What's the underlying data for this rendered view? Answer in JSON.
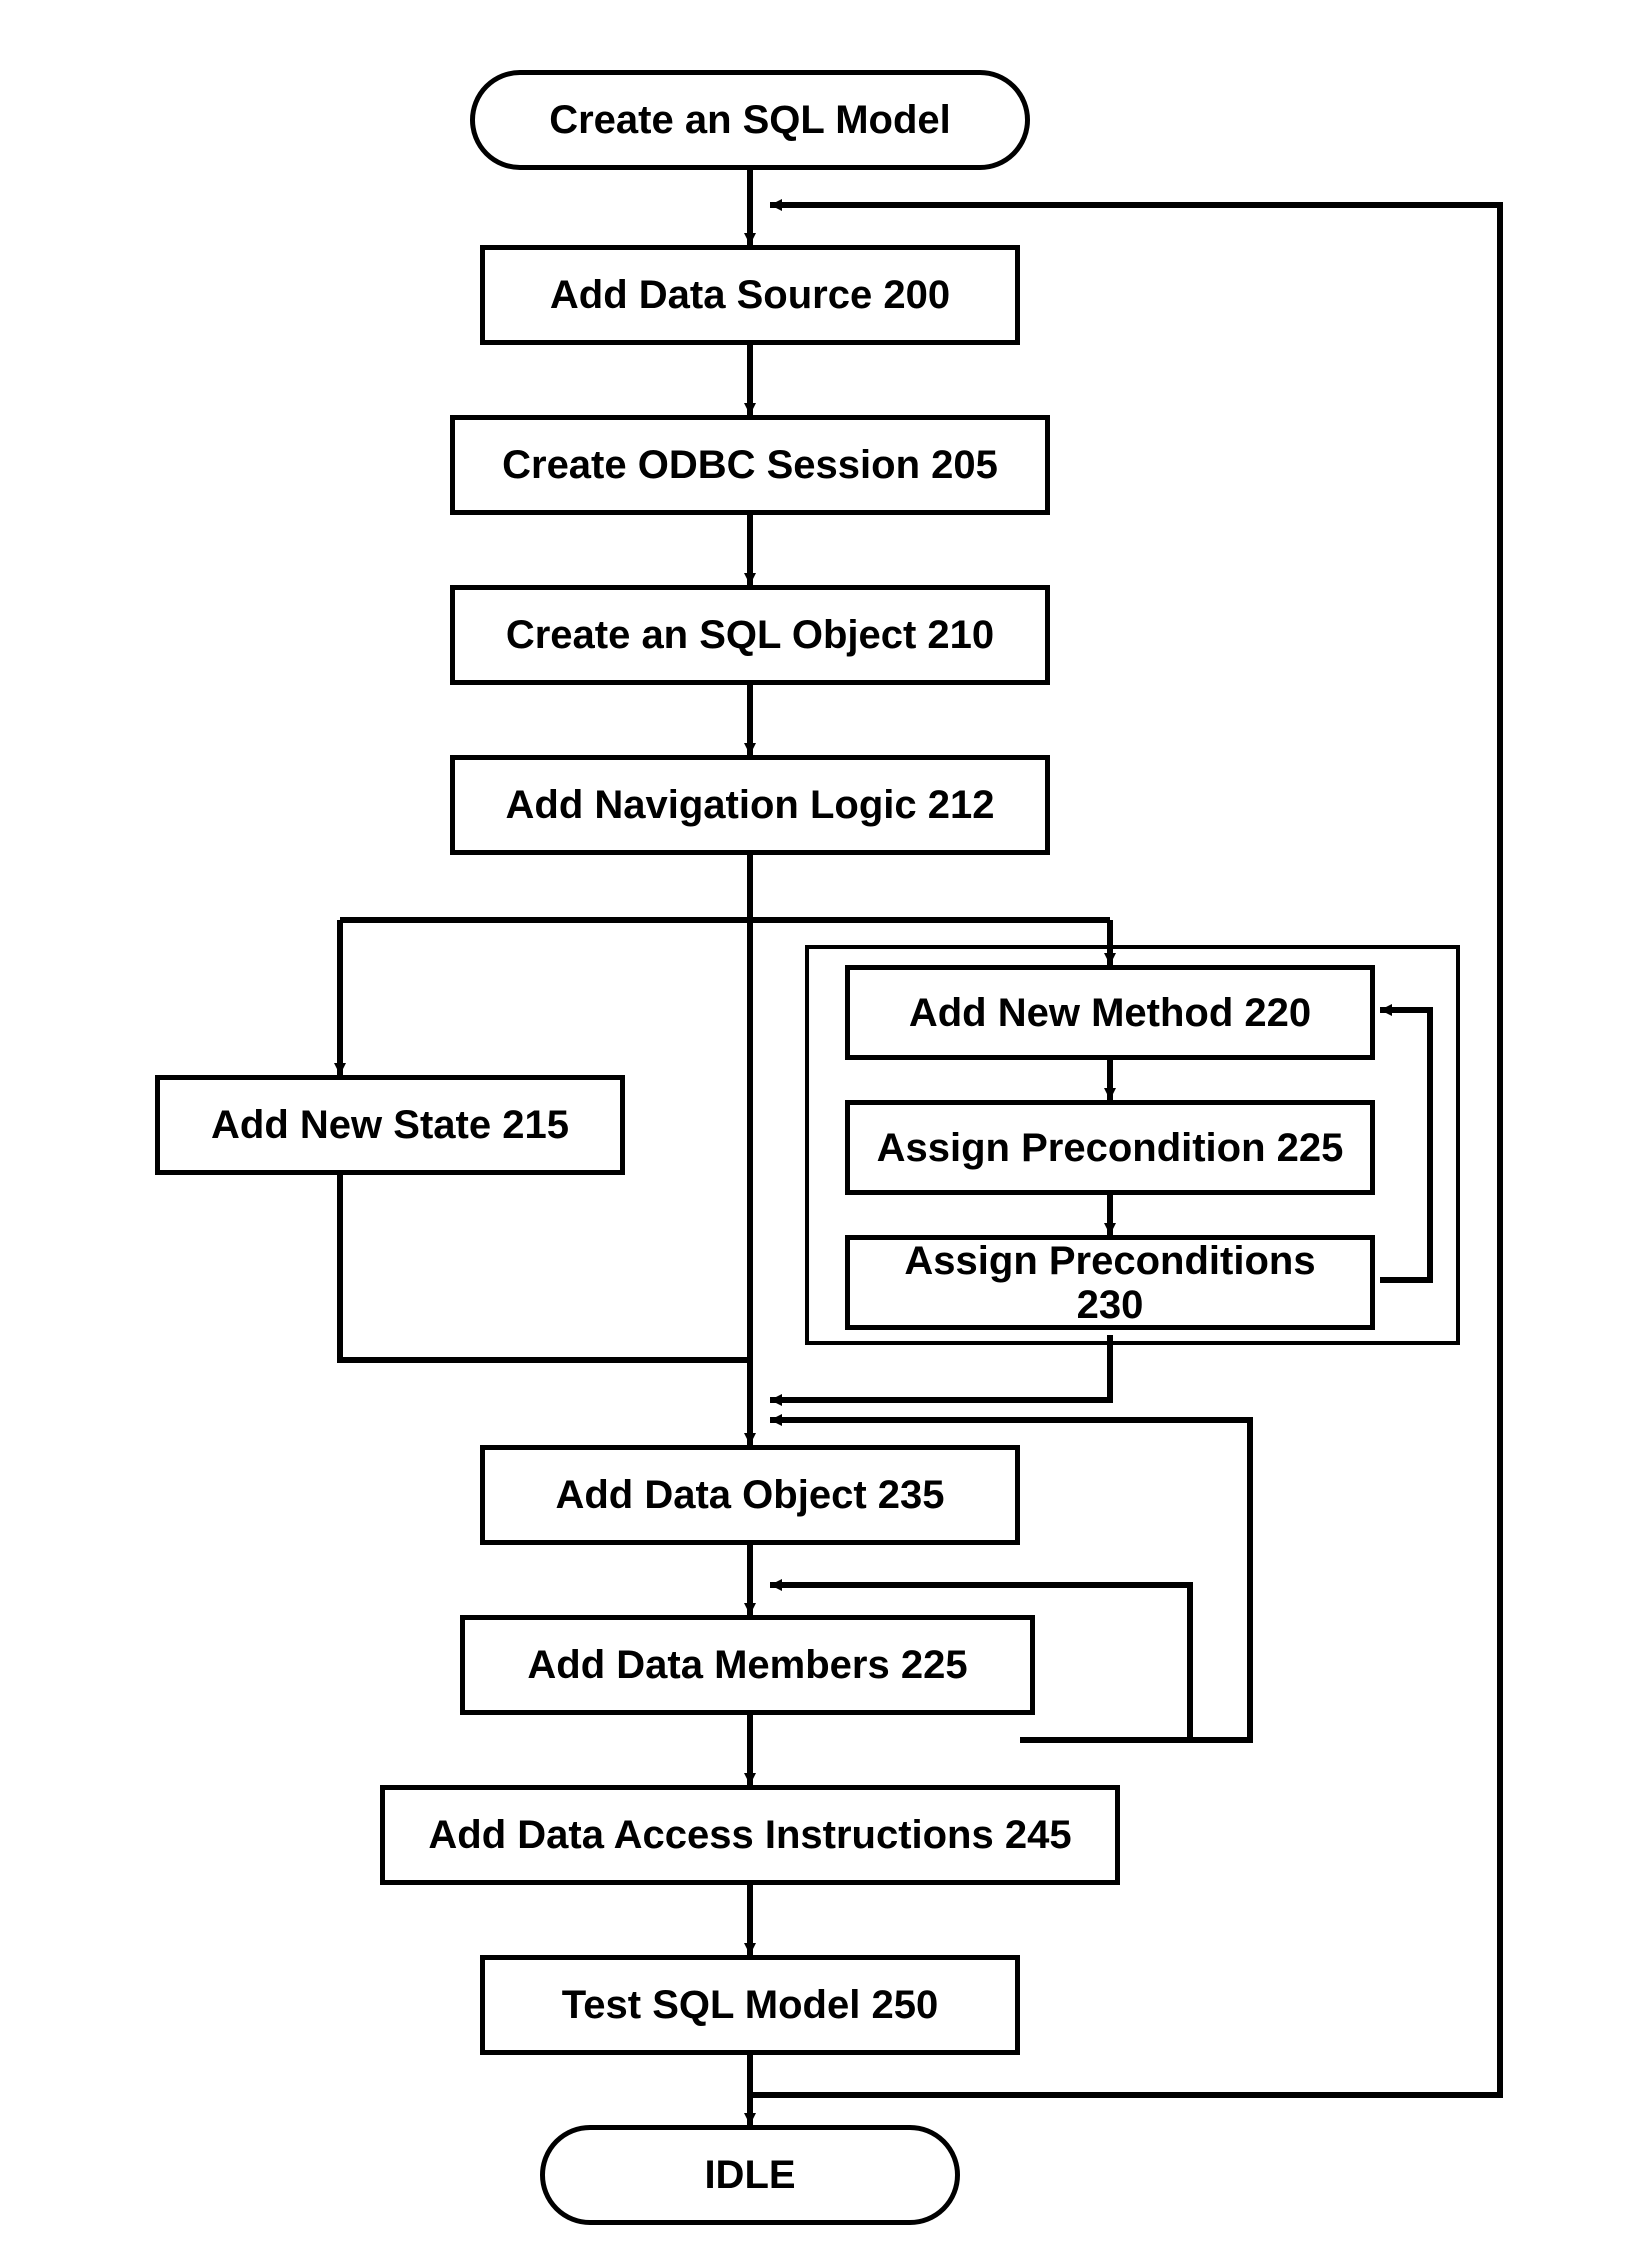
{
  "nodes": {
    "start": "Create an SQL Model",
    "n200": "Add Data Source 200",
    "n205": "Create ODBC Session 205",
    "n210": "Create an SQL Object 210",
    "n212": "Add Navigation Logic 212",
    "n215": "Add New State 215",
    "n220": "Add New Method 220",
    "n225": "Assign Precondition 225",
    "n230": "Assign Preconditions 230",
    "n235": "Add Data Object 235",
    "n225b": "Add Data Members 225",
    "n245": "Add Data Access Instructions 245",
    "n250": "Test SQL Model 250",
    "idle": "IDLE"
  }
}
